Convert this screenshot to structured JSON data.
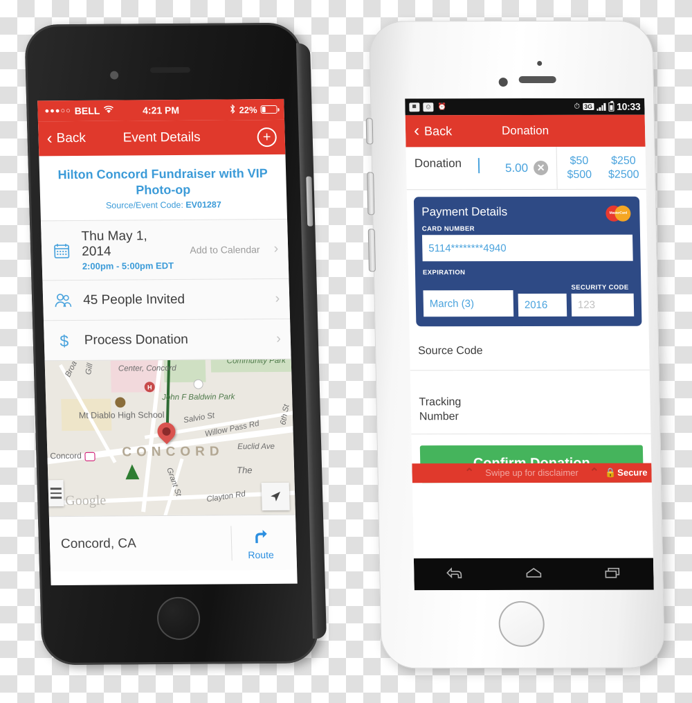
{
  "left_phone": {
    "device": "dark-iphone",
    "status_bar": {
      "signal_dots": "●●●○○",
      "carrier": "BELL",
      "wifi_icon": "wifi-icon",
      "time": "4:21 PM",
      "bluetooth_icon": "bluetooth-icon",
      "battery_percent": "22%",
      "battery_level": 22
    },
    "nav": {
      "back_label": "Back",
      "title": "Event Details",
      "add_label": "+"
    },
    "event": {
      "title": "Hilton Concord Fundraiser with VIP Photo-op",
      "code_label": "Source/Event Code:",
      "code_value": "EV01287"
    },
    "rows": [
      {
        "icon": "calendar-icon",
        "primary": "Thu May 1, 2014",
        "secondary": "2:00pm - 5:00pm EDT",
        "aux": "Add to Calendar",
        "arrow": "›"
      },
      {
        "icon": "people-icon",
        "primary": "45 People Invited",
        "secondary": "",
        "aux": "",
        "arrow": "›"
      },
      {
        "icon": "dollar-icon",
        "primary": "Process Donation",
        "secondary": "",
        "aux": "",
        "arrow": "›"
      }
    ],
    "map": {
      "labels": [
        "Center, Concord",
        "Community Park",
        "John F Baldwin Park",
        "Mt Diablo High School",
        "Salvio St",
        "Willow Pass Rd",
        "Euclid Ave",
        "6th St",
        "Concord",
        "Grant St",
        "Clayton Rd",
        "The",
        "Broa",
        "Gill"
      ],
      "city_label": "CONCORD",
      "watermark": "Google",
      "pin": "map-pin",
      "hospital_marker": "H"
    },
    "address_bar": {
      "address": "Concord, CA",
      "route_label": "Route",
      "route_icon": "route-arrow-icon"
    }
  },
  "right_phone": {
    "device": "white-iphone-android-ui",
    "status_bar": {
      "left_icons": [
        "image-icon",
        "message-icon",
        "alarm-clock-icon"
      ],
      "alarm_icon": "alarm-icon",
      "network": "3G",
      "signal_icon": "signal-bars-icon",
      "battery_icon": "battery-icon",
      "clock": "10:33"
    },
    "nav": {
      "back_label": "Back",
      "title": "Donation"
    },
    "donation": {
      "label": "Donation",
      "amount": "5.00",
      "clear_icon": "clear-x-icon",
      "presets": [
        "$50",
        "$250",
        "$500",
        "$2500"
      ]
    },
    "payment_card": {
      "heading": "Payment Details",
      "brand_icon": "mastercard-icon",
      "brand_text": "MasterCard",
      "card_number_label": "CARD NUMBER",
      "card_number_value": "5114********4940",
      "expiration_label": "EXPIRATION",
      "expiration_month": "March (3)",
      "expiration_year": "2016",
      "security_label": "SECURITY CODE",
      "security_placeholder": "123"
    },
    "fields": [
      {
        "label": "Source Code"
      },
      {
        "label": "Tracking\nNumber"
      }
    ],
    "confirm_label": "Confirm Donation",
    "footer": {
      "disclaimer": "Swipe up for disclaimer",
      "chevron_mark": "⌃",
      "secure_label": "Secure",
      "lock_icon": "lock-icon"
    },
    "softkeys": [
      "back-softkey",
      "home-softkey",
      "recents-softkey"
    ]
  },
  "colors": {
    "brand_red": "#e0392c",
    "accent_blue": "#4aa3dd",
    "card_blue": "#2e4a85",
    "confirm_green": "#45b45c",
    "map_green": "#cfe0c3",
    "pin_red": "#d9534f"
  }
}
